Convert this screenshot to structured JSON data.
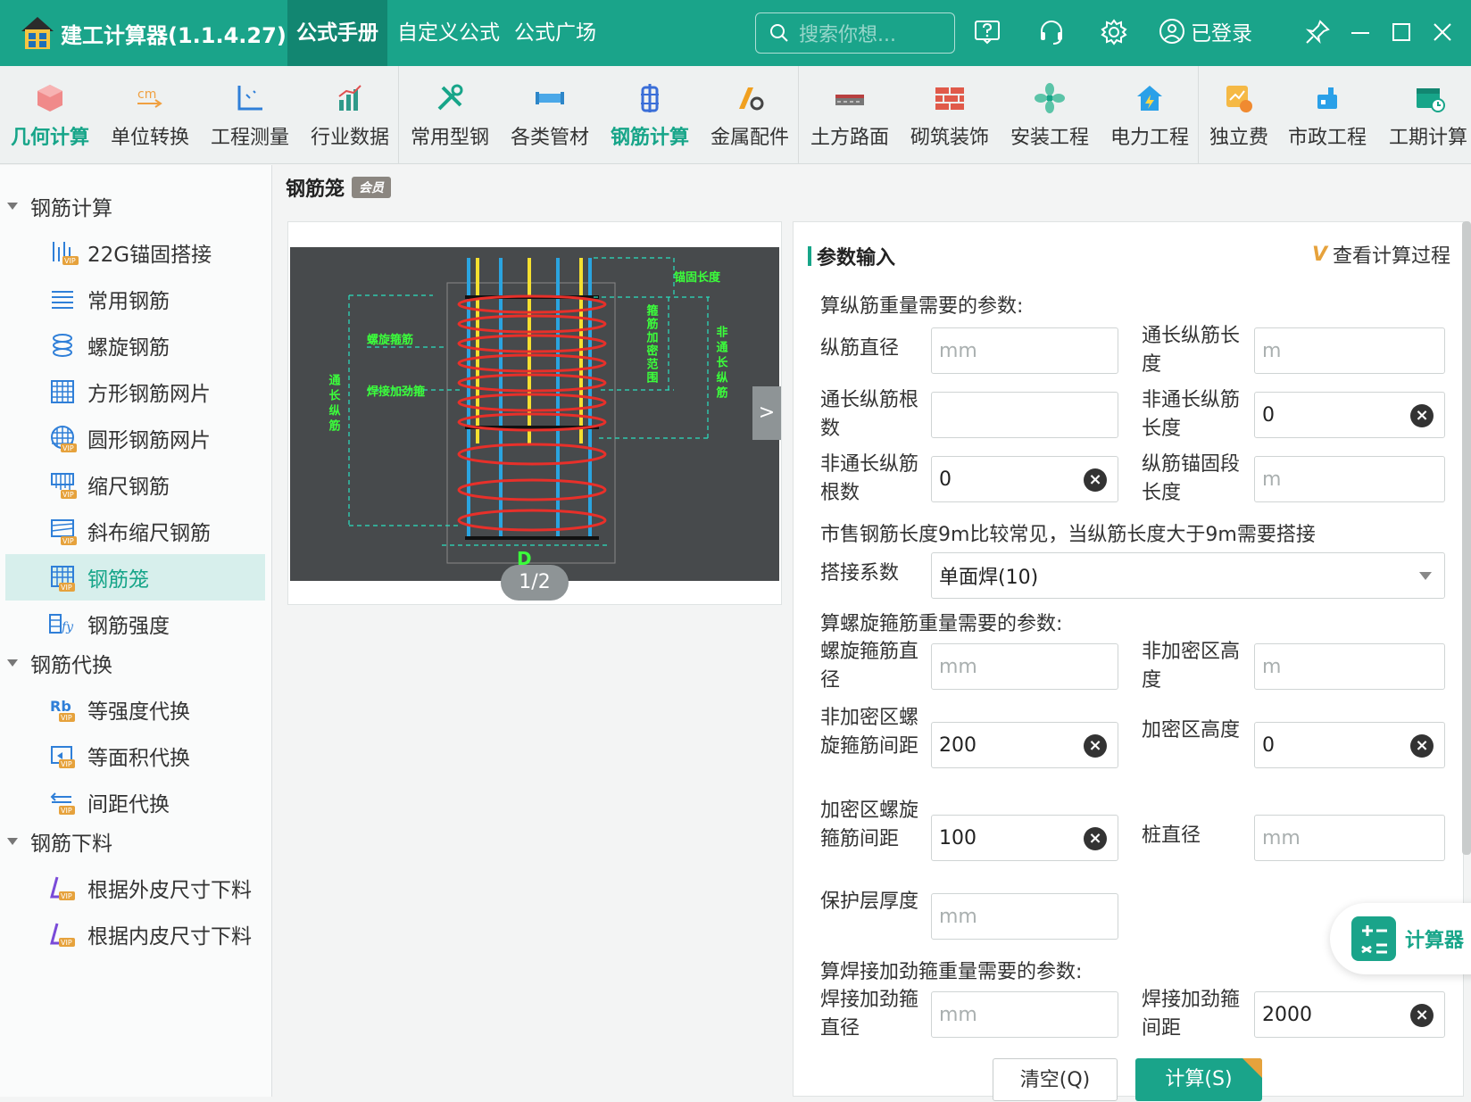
{
  "titlebar": {
    "app_title": "建工计算器(1.1.4.27)",
    "tabs": [
      "公式手册",
      "自定义公式",
      "公式广场"
    ],
    "active_tab": "公式手册",
    "search_placeholder": "搜索你想...",
    "login_label": "已登录"
  },
  "toolbar": {
    "items": [
      {
        "label": "几何计算",
        "icon": "cube-icon"
      },
      {
        "label": "单位转换",
        "icon": "unit-convert-icon"
      },
      {
        "label": "工程测量",
        "icon": "measure-icon"
      },
      {
        "label": "行业数据",
        "icon": "bar-chart-icon"
      },
      {
        "label": "常用型钢",
        "icon": "tools-icon"
      },
      {
        "label": "各类管材",
        "icon": "pipe-icon"
      },
      {
        "label": "钢筋计算",
        "icon": "rebar-icon"
      },
      {
        "label": "金属配件",
        "icon": "metal-fitting-icon"
      },
      {
        "label": "土方路面",
        "icon": "road-icon"
      },
      {
        "label": "砌筑装饰",
        "icon": "brick-icon"
      },
      {
        "label": "安装工程",
        "icon": "fan-icon"
      },
      {
        "label": "电力工程",
        "icon": "power-icon"
      },
      {
        "label": "独立费",
        "icon": "fee-icon"
      },
      {
        "label": "市政工程",
        "icon": "municipal-icon"
      },
      {
        "label": "工期计算",
        "icon": "calendar-icon"
      }
    ],
    "active_item": "钢筋计算",
    "colors": {
      "accent": "#17a589",
      "active_label": "#17a589"
    }
  },
  "sidebar": {
    "groups": [
      {
        "label": "钢筋计算",
        "items": [
          "22G锚固搭接",
          "常用钢筋",
          "螺旋钢筋",
          "方形钢筋网片",
          "圆形钢筋网片",
          "缩尺钢筋",
          "斜布缩尺钢筋",
          "钢筋笼",
          "钢筋强度"
        ]
      },
      {
        "label": "钢筋代换",
        "items": [
          "等强度代换",
          "等面积代换",
          "间距代换"
        ]
      },
      {
        "label": "钢筋下料",
        "items": [
          "根据外皮尺寸下料",
          "根据内皮尺寸下料"
        ]
      }
    ],
    "active_item": "钢筋笼"
  },
  "page": {
    "title": "钢筋笼",
    "badge": "会员"
  },
  "diagram": {
    "labels": {
      "anchor_length": "锚固长度",
      "spiral_stirrup": "螺旋箍筋",
      "weld_stiffener": "焊接加劲箍",
      "stirrup_dense": "箍筋加密范围",
      "full_length_bar": "通长纵筋",
      "non_full_length_bar": "非通长纵筋",
      "diameter": "D"
    },
    "pager": "1/2",
    "next": ">"
  },
  "form": {
    "section_title": "参数输入",
    "view_process": "查看计算过程",
    "note_longitudinal": "算纵筋重量需要的参数:",
    "note_market": "市售钢筋长度9m比较常见，当纵筋长度大于9m需要搭接",
    "note_spiral": "算螺旋箍筋重量需要的参数:",
    "note_weld": "算焊接加劲箍重量需要的参数:",
    "fields": {
      "bar_diameter": {
        "label": "纵筋直径",
        "value": "",
        "placeholder": "mm"
      },
      "full_bar_length": {
        "label": "通长纵筋长度",
        "value": "",
        "placeholder": "m"
      },
      "full_bar_count": {
        "label": "通长纵筋根数",
        "value": "",
        "placeholder": ""
      },
      "nonfull_bar_length": {
        "label": "非通长纵筋长度",
        "value": "0",
        "placeholder": ""
      },
      "nonfull_bar_count": {
        "label": "非通长纵筋根数",
        "value": "0",
        "placeholder": ""
      },
      "anchor_length": {
        "label": "纵筋锚固段长度",
        "value": "",
        "placeholder": "m"
      },
      "lap_factor": {
        "label": "搭接系数",
        "value": "单面焊(10)"
      },
      "spiral_diameter": {
        "label": "螺旋箍筋直径",
        "value": "",
        "placeholder": "mm"
      },
      "nondense_height": {
        "label": "非加密区高度",
        "value": "",
        "placeholder": "m"
      },
      "nondense_spacing": {
        "label": "非加密区螺旋箍筋间距",
        "value": "200",
        "placeholder": ""
      },
      "dense_height": {
        "label": "加密区高度",
        "value": "0",
        "placeholder": ""
      },
      "dense_spacing": {
        "label": "加密区螺旋箍筋间距",
        "value": "100",
        "placeholder": ""
      },
      "pile_diameter": {
        "label": "桩直径",
        "value": "",
        "placeholder": "mm"
      },
      "cover_thickness": {
        "label": "保护层厚度",
        "value": "",
        "placeholder": "mm"
      },
      "weld_diameter": {
        "label": "焊接加劲箍直径",
        "value": "",
        "placeholder": "mm"
      },
      "weld_spacing": {
        "label": "焊接加劲箍间距",
        "value": "2000",
        "placeholder": ""
      }
    },
    "btn_clear": "清空(Q)",
    "btn_calc": "计算(S)"
  },
  "float_calc": {
    "label": "计算器"
  }
}
